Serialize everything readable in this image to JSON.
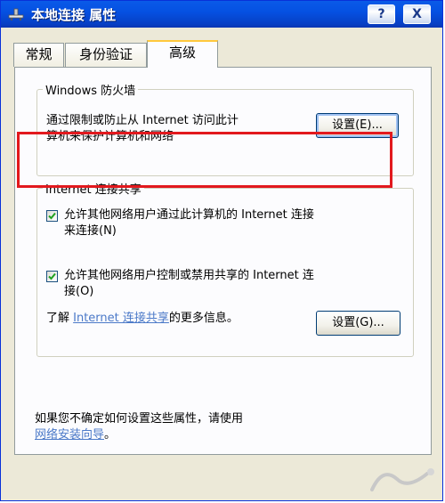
{
  "window": {
    "title": "本地连接 属性",
    "help_button": "?",
    "close_button": "X"
  },
  "tabs": [
    {
      "label": "常规",
      "active": false
    },
    {
      "label": "身份验证",
      "active": false
    },
    {
      "label": "高级",
      "active": true
    }
  ],
  "firewall": {
    "group_title": "Windows 防火墙",
    "description_line1": "通过限制或防止从 Internet 访问此计",
    "description_line2": "算机来保护计算机和网络",
    "settings_button": "设置(E)..."
  },
  "ics": {
    "group_title": "Internet 连接共享",
    "allow_connect": {
      "checked": true,
      "line1": "允许其他网络用户通过此计算机的 Internet 连接",
      "line2": "来连接(N)"
    },
    "allow_control": {
      "checked": true,
      "line1": "允许其他网络用户控制或禁用共享的 Internet 连",
      "line2": "接(O)"
    },
    "learn_prefix": "了解 ",
    "learn_link": "Internet 连接共享",
    "learn_suffix": "的更多信息。",
    "settings_button": "设置(G)..."
  },
  "footer": {
    "text": "如果您不确定如何设置这些属性，请使用",
    "link": "网络安装向导",
    "suffix": "。"
  },
  "colors": {
    "titlebar": "#0551e2",
    "highlight": "#e2191e",
    "link": "#4b79c8"
  }
}
